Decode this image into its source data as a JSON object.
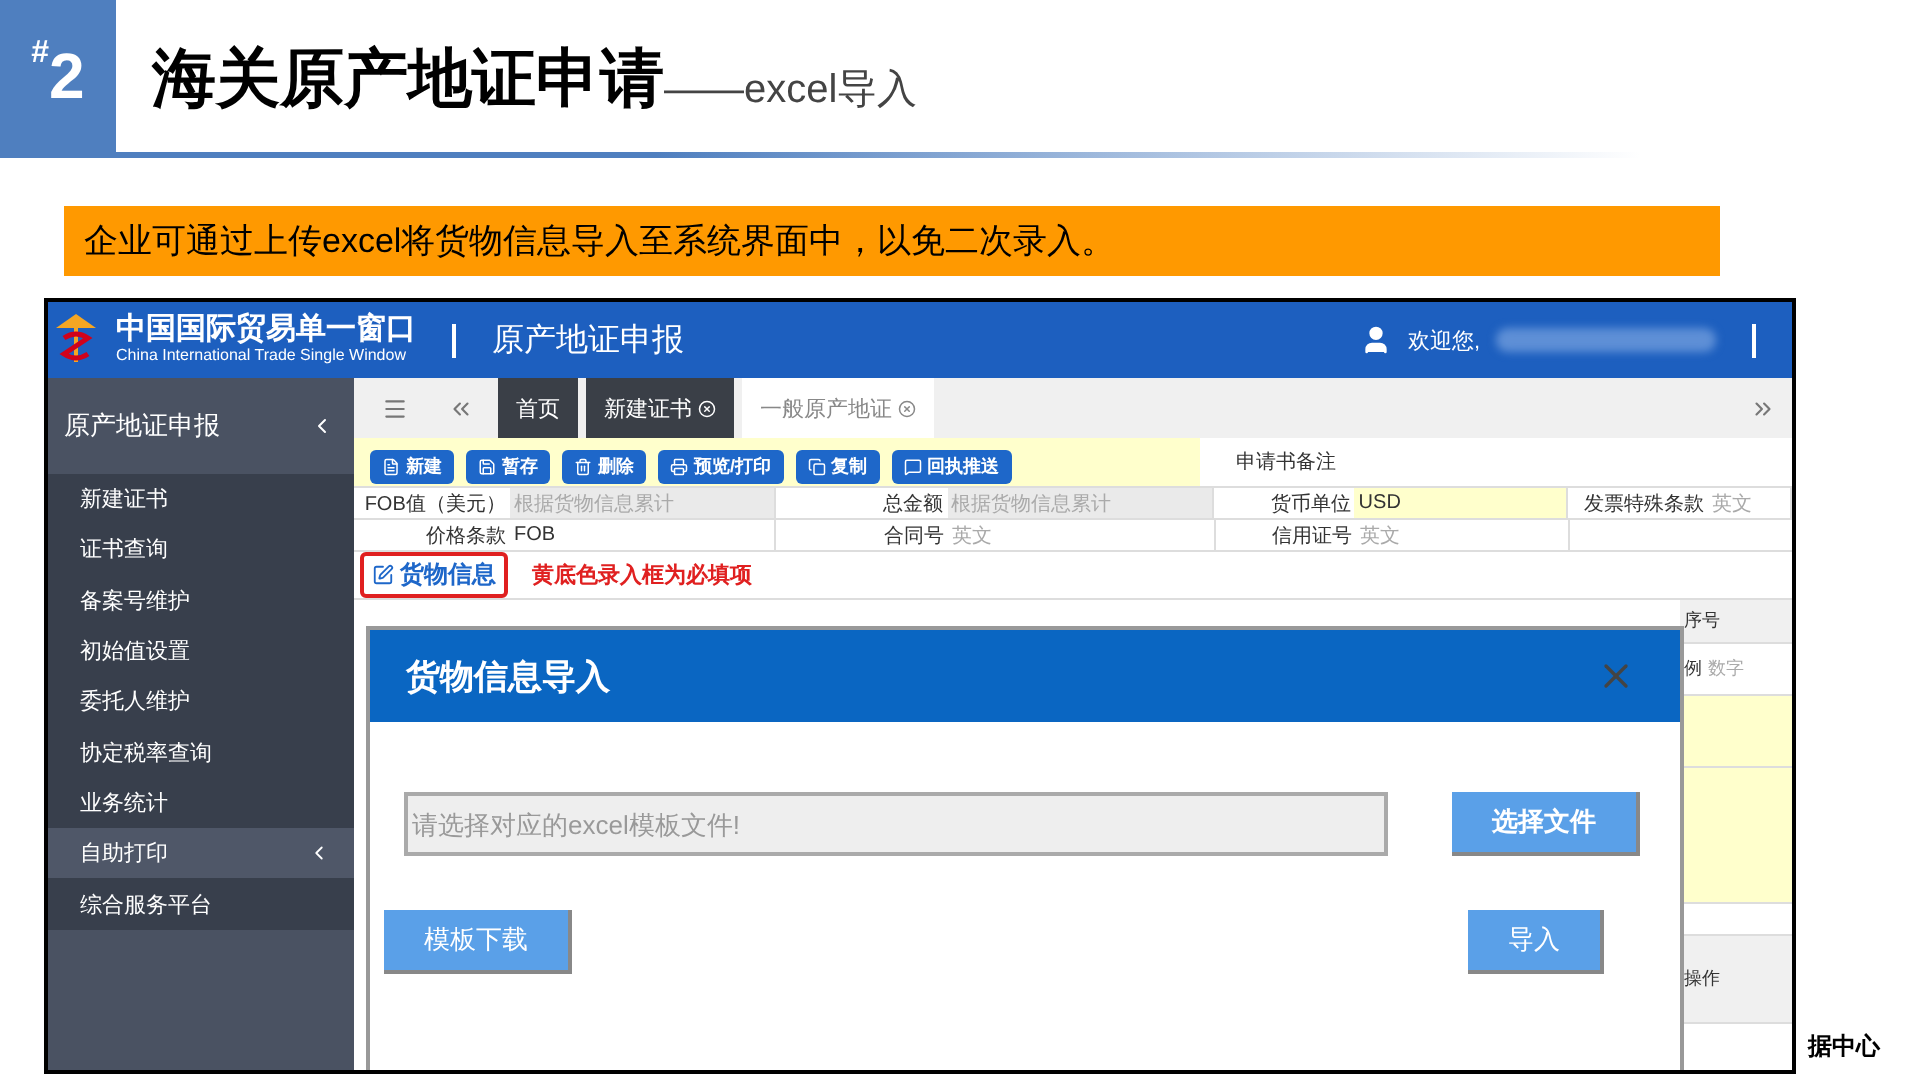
{
  "slide": {
    "number_mark": "#",
    "number": "2",
    "title": "海关原产地证申请",
    "subtitle": "——excel导入",
    "note": "企业可通过上传excel将货物信息导入至系统界面中，以免二次录入。",
    "footer_logo_text": "据中心"
  },
  "app": {
    "brand_title": "中国国际贸易单一窗口",
    "brand_subtitle": "China International Trade Single Window",
    "module_title": "原产地证申报",
    "welcome": "欢迎您,",
    "sidebar": {
      "title": "原产地证申报",
      "items": [
        {
          "label": "新建证书",
          "kind": "link",
          "selected": false
        },
        {
          "label": "证书查询",
          "kind": "link",
          "selected": false
        },
        {
          "label": "备案号维护",
          "kind": "link",
          "selected": false
        },
        {
          "label": "初始值设置",
          "kind": "link",
          "selected": false
        },
        {
          "label": "委托人维护",
          "kind": "link",
          "selected": false
        },
        {
          "label": "协定税率查询",
          "kind": "link",
          "selected": false
        },
        {
          "label": "业务统计",
          "kind": "link",
          "selected": false
        },
        {
          "label": "自助打印",
          "kind": "group",
          "selected": true
        },
        {
          "label": "综合服务平台",
          "kind": "link",
          "selected": false
        }
      ]
    },
    "tabs": [
      {
        "label": "首页",
        "closable": false,
        "selected": false
      },
      {
        "label": "新建证书",
        "closable": true,
        "selected": false
      },
      {
        "label": "一般原产地证",
        "closable": true,
        "selected": true
      }
    ],
    "toolbar": [
      {
        "label": "新建",
        "kind": "new"
      },
      {
        "label": "暂存",
        "kind": "save"
      },
      {
        "label": "删除",
        "kind": "delete"
      },
      {
        "label": "预览/打印",
        "kind": "print"
      },
      {
        "label": "复制",
        "kind": "copy"
      },
      {
        "label": "回执推送",
        "kind": "push"
      }
    ],
    "remark_label": "申请书备注",
    "form_rows": [
      [
        {
          "label": "FOB值（美元）",
          "text": "根据货物信息累计",
          "kind": "auto"
        },
        {
          "label": "总金额",
          "text": "根据货物信息累计",
          "kind": "auto"
        },
        {
          "label": "货币单位",
          "text": "USD",
          "kind": "required"
        },
        {
          "label": "发票特殊条款",
          "text": "英文",
          "kind": "hint"
        }
      ],
      [
        {
          "label": "价格条款",
          "text": "FOB",
          "kind": "input"
        },
        {
          "label": "合同号",
          "text": "英文",
          "kind": "hint"
        },
        {
          "label": "信用证号",
          "text": "英文",
          "kind": "hint"
        }
      ]
    ],
    "goods_section": {
      "title": "货物信息",
      "note": "黄底色录入框为必填项"
    },
    "goods_side": {
      "header": "序号",
      "ratio_label": "例",
      "ratio_hint": "数字",
      "action_label": "操作"
    },
    "dialog": {
      "title": "货物信息导入",
      "file_placeholder": "请选择对应的excel模板文件!",
      "choose_button": "选择文件",
      "download_button": "模板下载",
      "import_button": "导入"
    }
  }
}
